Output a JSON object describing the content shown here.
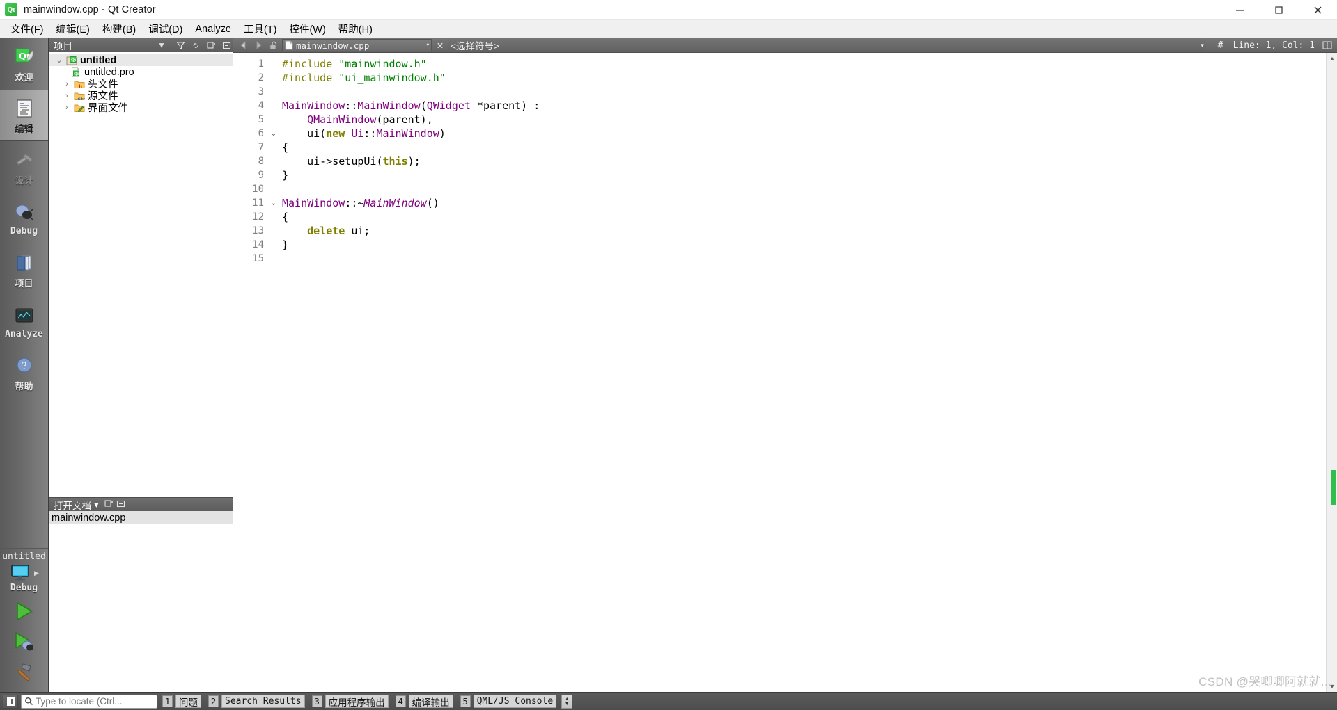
{
  "window": {
    "title": "mainwindow.cpp - Qt Creator",
    "logo_text": "Qt",
    "minimize": "─",
    "maximize": "☐",
    "close": "✕"
  },
  "menubar": {
    "items": [
      {
        "label": "文件(F)",
        "name": "menu-file"
      },
      {
        "label": "编辑(E)",
        "name": "menu-edit"
      },
      {
        "label": "构建(B)",
        "name": "menu-build"
      },
      {
        "label": "调试(D)",
        "name": "menu-debug"
      },
      {
        "label": "Analyze",
        "name": "menu-analyze"
      },
      {
        "label": "工具(T)",
        "name": "menu-tools"
      },
      {
        "label": "控件(W)",
        "name": "menu-window"
      },
      {
        "label": "帮助(H)",
        "name": "menu-help"
      }
    ]
  },
  "modebar": {
    "modes": [
      {
        "label": "欢迎",
        "icon": "qt-welcome-icon",
        "state": "normal"
      },
      {
        "label": "编辑",
        "icon": "edit-document-icon",
        "state": "active"
      },
      {
        "label": "设计",
        "icon": "design-brush-icon",
        "state": "disabled"
      },
      {
        "label": "Debug",
        "icon": "debug-bug-icon",
        "state": "normal"
      },
      {
        "label": "项目",
        "icon": "projects-folders-icon",
        "state": "normal"
      },
      {
        "label": "Analyze",
        "icon": "analyze-monitor-icon",
        "state": "normal"
      },
      {
        "label": "帮助",
        "icon": "help-question-icon",
        "state": "normal"
      }
    ],
    "kit": {
      "project_name": "untitled",
      "build_config": "Debug",
      "target_icon": "desktop-monitor-icon",
      "run_button": "run-green-arrow-icon",
      "debug_button": "debug-run-icon",
      "build_button": "build-hammer-icon"
    }
  },
  "leftdock": {
    "projects_header": {
      "title": "项目",
      "dropdown": "▾",
      "filter_icon": "filter-funnel-icon",
      "link_icon": "sync-link-icon",
      "split_icon": "split-pane-icon",
      "close_icon": "close-pane-icon"
    },
    "tree": [
      {
        "label": "untitled",
        "depth": 0,
        "twist": "⌄",
        "icon": "qt-project-icon",
        "bold": true,
        "selected": true
      },
      {
        "label": "untitled.pro",
        "depth": 1,
        "twist": "",
        "icon": "qt-pro-file-icon",
        "bold": false,
        "selected": false
      },
      {
        "label": "头文件",
        "depth": 1,
        "twist": "›",
        "icon": "folder-h-icon",
        "bold": false,
        "selected": false
      },
      {
        "label": "源文件",
        "depth": 1,
        "twist": "›",
        "icon": "folder-cpp-icon",
        "bold": false,
        "selected": false
      },
      {
        "label": "界面文件",
        "depth": 1,
        "twist": "›",
        "icon": "folder-ui-icon",
        "bold": false,
        "selected": false
      }
    ],
    "opendocs_header": {
      "title": "打开文档",
      "dropdown": "▾",
      "split_icon": "split-pane-icon",
      "close_icon": "close-pane-icon"
    },
    "opendocs": [
      {
        "label": "mainwindow.cpp",
        "selected": true
      }
    ]
  },
  "editor": {
    "toolbar": {
      "back_icon": "nav-back-icon",
      "forward_icon": "nav-forward-icon",
      "lock_icon": "unlocked-padlock-icon",
      "file_name": "mainwindow.cpp",
      "file_dropdown": "▾",
      "close_icon": "✕",
      "symbol_placeholder": "<选择符号>",
      "symbol_dropdown": "▾",
      "linecol_hash": "#",
      "linecol": "Line: 1, Col: 1",
      "split_icon": "split-editor-icon"
    },
    "line_count": 15,
    "lines": [
      {
        "n": 1,
        "fold": "",
        "tokens": [
          {
            "t": "#include ",
            "c": "k-pp"
          },
          {
            "t": "\"mainwindow.h\"",
            "c": "k-str"
          }
        ]
      },
      {
        "n": 2,
        "fold": "",
        "tokens": [
          {
            "t": "#include ",
            "c": "k-pp"
          },
          {
            "t": "\"ui_mainwindow.h\"",
            "c": "k-str"
          }
        ]
      },
      {
        "n": 3,
        "fold": "",
        "tokens": []
      },
      {
        "n": 4,
        "fold": "",
        "tokens": [
          {
            "t": "MainWindow",
            "c": "k-type"
          },
          {
            "t": "::",
            "c": "k-var"
          },
          {
            "t": "MainWindow",
            "c": "k-type"
          },
          {
            "t": "(",
            "c": "k-var"
          },
          {
            "t": "QWidget",
            "c": "k-type"
          },
          {
            "t": " *parent) :",
            "c": "k-var"
          }
        ]
      },
      {
        "n": 5,
        "fold": "",
        "tokens": [
          {
            "t": "    ",
            "c": "k-var"
          },
          {
            "t": "QMainWindow",
            "c": "k-type"
          },
          {
            "t": "(parent),",
            "c": "k-var"
          }
        ]
      },
      {
        "n": 6,
        "fold": "⌄",
        "tokens": [
          {
            "t": "    ui(",
            "c": "k-var"
          },
          {
            "t": "new",
            "c": "k-kw"
          },
          {
            "t": " ",
            "c": "k-var"
          },
          {
            "t": "Ui",
            "c": "k-type"
          },
          {
            "t": "::",
            "c": "k-var"
          },
          {
            "t": "MainWindow",
            "c": "k-type"
          },
          {
            "t": ")",
            "c": "k-var"
          }
        ]
      },
      {
        "n": 7,
        "fold": "",
        "tokens": [
          {
            "t": "{",
            "c": "k-var"
          }
        ]
      },
      {
        "n": 8,
        "fold": "",
        "tokens": [
          {
            "t": "    ui->setupUi(",
            "c": "k-var"
          },
          {
            "t": "this",
            "c": "k-kw"
          },
          {
            "t": ");",
            "c": "k-var"
          }
        ]
      },
      {
        "n": 9,
        "fold": "",
        "tokens": [
          {
            "t": "}",
            "c": "k-var"
          }
        ]
      },
      {
        "n": 10,
        "fold": "",
        "tokens": []
      },
      {
        "n": 11,
        "fold": "⌄",
        "tokens": [
          {
            "t": "MainWindow",
            "c": "k-type"
          },
          {
            "t": "::~",
            "c": "k-var"
          },
          {
            "t": "MainWindow",
            "c": "k-type k-ital"
          },
          {
            "t": "()",
            "c": "k-var"
          }
        ]
      },
      {
        "n": 12,
        "fold": "",
        "tokens": [
          {
            "t": "{",
            "c": "k-var"
          }
        ]
      },
      {
        "n": 13,
        "fold": "",
        "tokens": [
          {
            "t": "    ",
            "c": "k-var"
          },
          {
            "t": "delete",
            "c": "k-kw"
          },
          {
            "t": " ui;",
            "c": "k-var"
          }
        ]
      },
      {
        "n": 14,
        "fold": "",
        "tokens": [
          {
            "t": "}",
            "c": "k-var"
          }
        ]
      },
      {
        "n": 15,
        "fold": "",
        "tokens": []
      }
    ],
    "scroll_marker_color": "#2fbf4f"
  },
  "statusbar": {
    "sidebar_toggle": "toggle-sidebar-icon",
    "search_placeholder": "Type to locate (Ctrl...",
    "search_value": "",
    "search_icon": "magnifier-icon",
    "panels": [
      {
        "num": "1",
        "label": "问题",
        "cjk": true
      },
      {
        "num": "2",
        "label": "Search Results",
        "cjk": false
      },
      {
        "num": "3",
        "label": "应用程序输出",
        "cjk": true
      },
      {
        "num": "4",
        "label": "编译输出",
        "cjk": true
      },
      {
        "num": "5",
        "label": "QML/JS Console",
        "cjk": false
      }
    ],
    "spinner": "output-pane-spinner"
  },
  "watermark": "CSDN @哭唧唧阿就就..."
}
